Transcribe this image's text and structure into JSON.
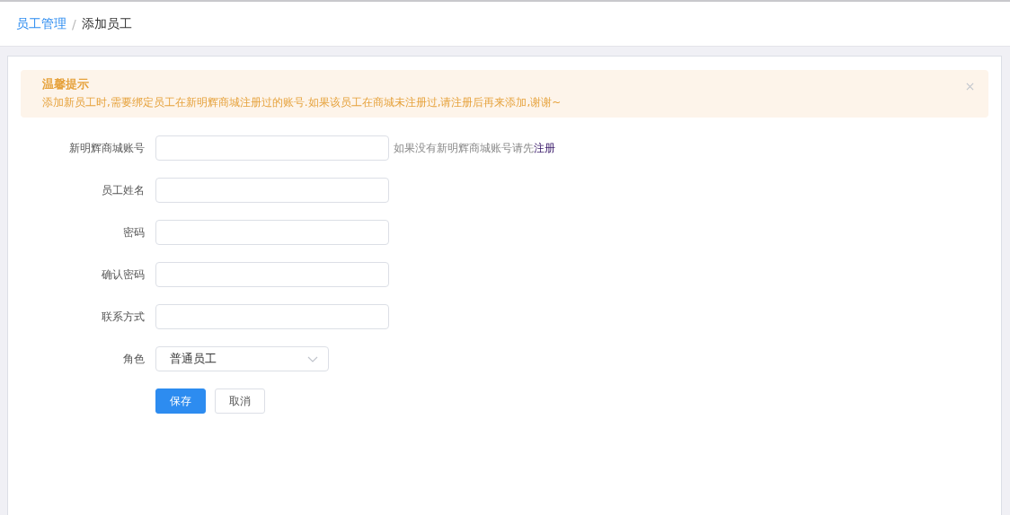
{
  "breadcrumb": [
    {
      "label": "员工管理",
      "kind": "link"
    },
    {
      "label": "添加员工",
      "kind": "current"
    }
  ],
  "breadcrumb_separator": "/",
  "alert": {
    "title": "温馨提示",
    "message": "添加新员工时,需要绑定员工在新明辉商城注册过的账号.如果该员工在商城未注册过,请注册后再来添加,谢谢~",
    "closable": true
  },
  "form": {
    "fields": [
      {
        "label": "新明辉商城账号",
        "kind": "input",
        "hint": "如果没有新明辉商城账号请先",
        "hint_link": "注册"
      },
      {
        "label": "员工姓名",
        "kind": "input"
      },
      {
        "label": "密码",
        "kind": "input"
      },
      {
        "label": "确认密码",
        "kind": "input"
      },
      {
        "label": "联系方式",
        "kind": "input"
      },
      {
        "label": "角色",
        "kind": "select",
        "value": "普通员工"
      }
    ],
    "buttons": [
      {
        "label": "保存",
        "kind": "primary"
      },
      {
        "label": "取消",
        "kind": "default"
      }
    ]
  }
}
